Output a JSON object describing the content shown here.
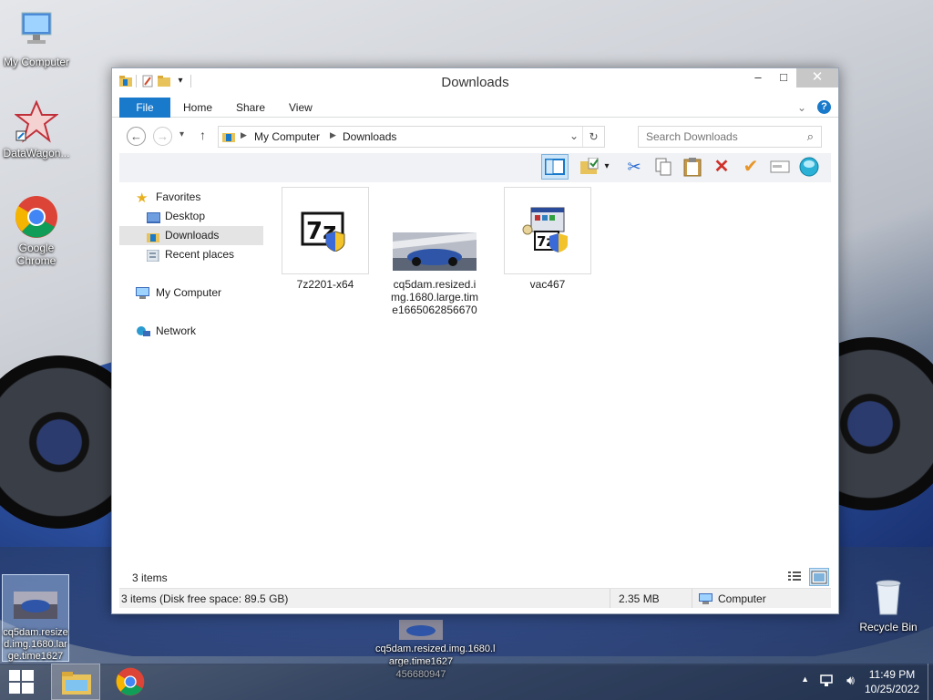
{
  "desktop": {
    "icons": [
      {
        "label": "My Computer"
      },
      {
        "label": "DataWagon..."
      },
      {
        "label": "Google Chrome"
      },
      {
        "label": "cq5dam.resized.img.1680.large.time1627"
      },
      {
        "label": "Recycle Bin"
      }
    ],
    "drag_label": "cq5dam.resized.img.1680.l arge.time1627 456680947"
  },
  "window": {
    "title": "Downloads",
    "ribbon": {
      "file": "File",
      "tabs": [
        "Home",
        "Share",
        "View"
      ]
    },
    "address": {
      "root": "My Computer",
      "current": "Downloads"
    },
    "search": {
      "placeholder": "Search Downloads"
    },
    "nav": {
      "favorites": "Favorites",
      "favorites_items": [
        "Desktop",
        "Downloads",
        "Recent places"
      ],
      "computer": "My Computer",
      "network": "Network"
    },
    "files": [
      {
        "name": "7z2201-x64"
      },
      {
        "name": "cq5dam.resized.img.1680.large.time1665062856670"
      },
      {
        "name": "vac467"
      }
    ],
    "item_count": "3 items",
    "status": {
      "left": "3 items (Disk free space: 89.5 GB)",
      "size": "2.35 MB",
      "location": "Computer"
    }
  },
  "taskbar": {
    "time": "11:49 PM",
    "date": "10/25/2022"
  },
  "colors": {
    "accent": "#1979ca",
    "close": "#c7c7c7"
  }
}
